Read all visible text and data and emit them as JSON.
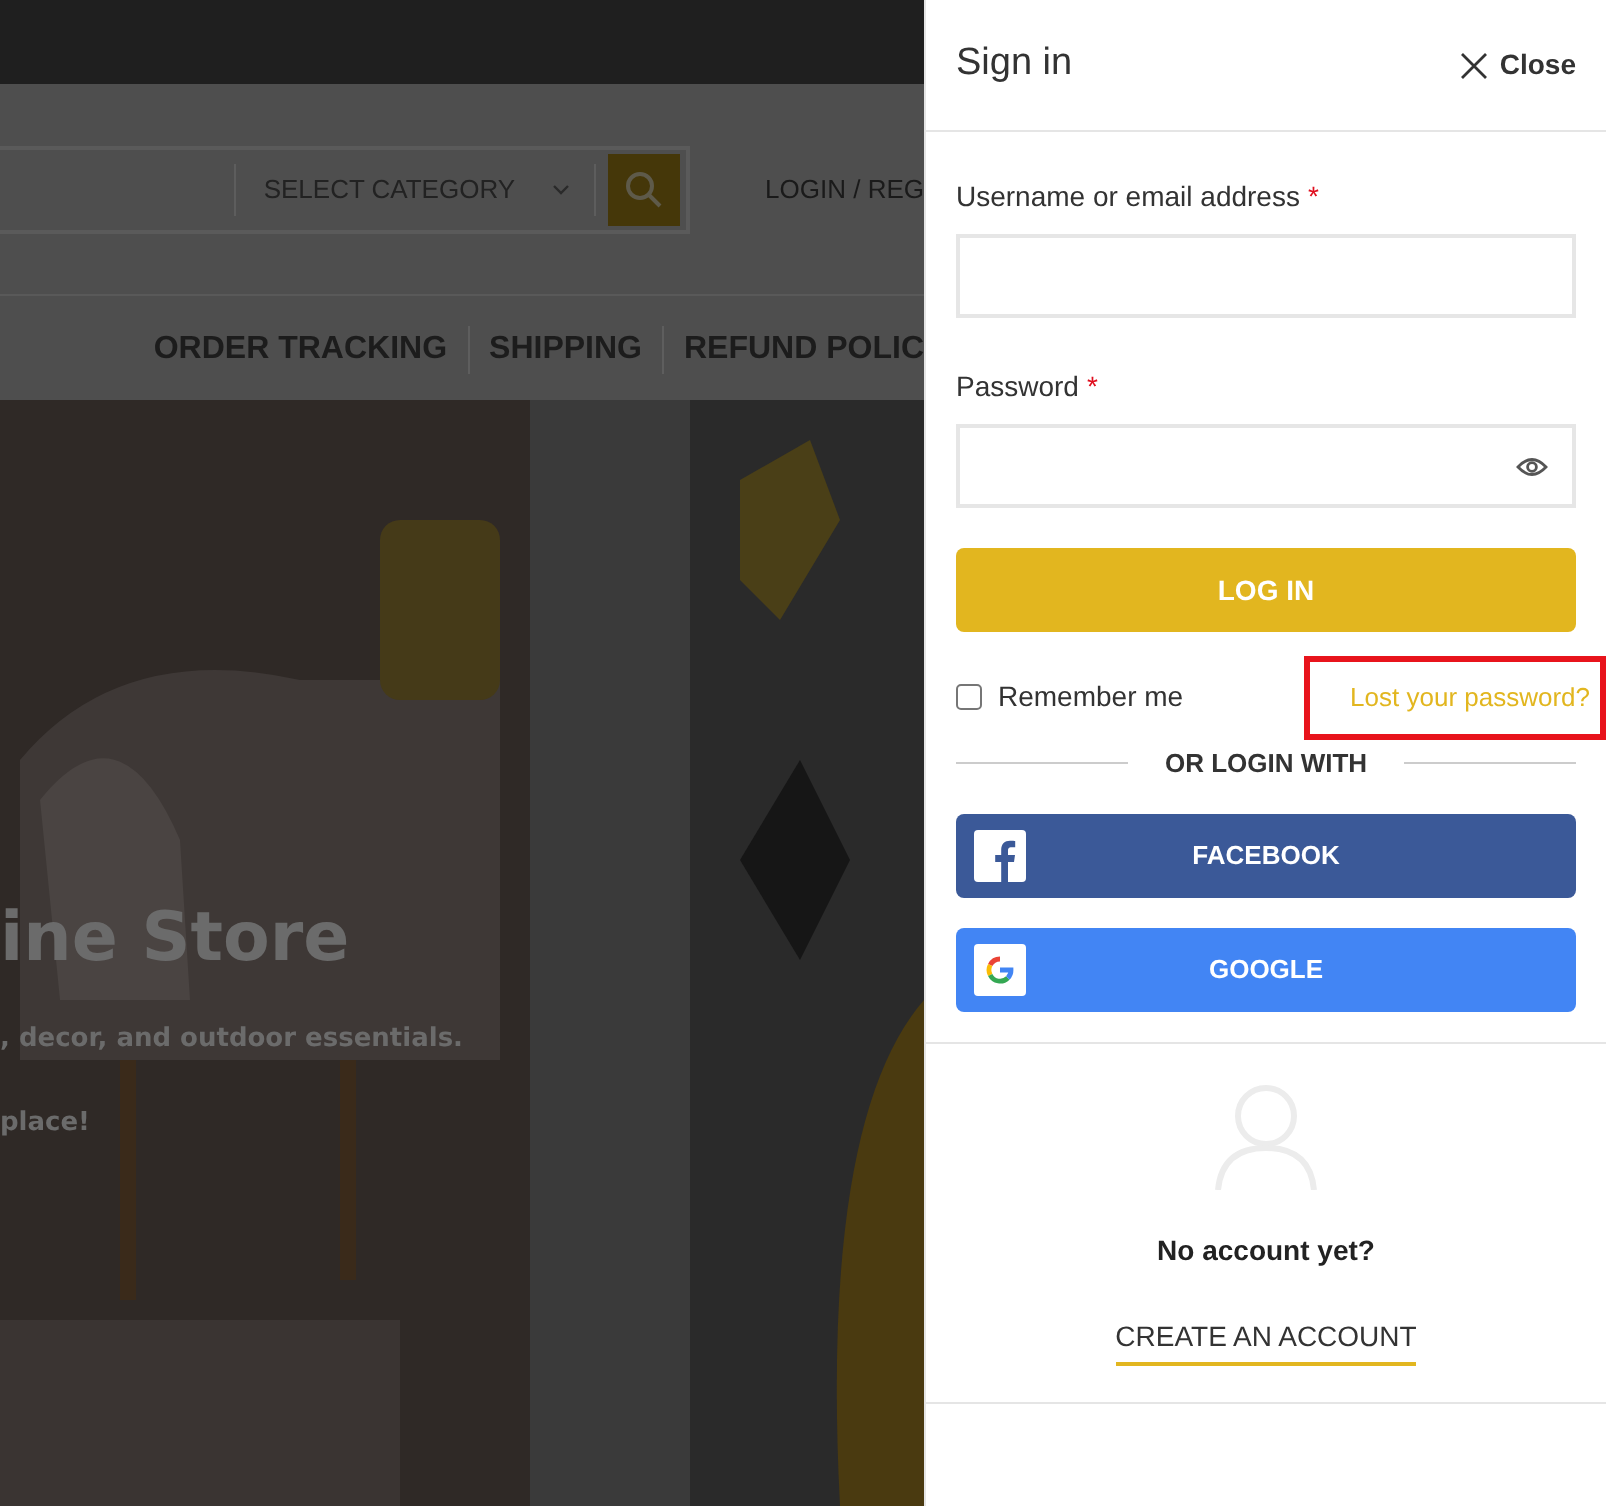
{
  "header": {
    "search_category": "SELECT CATEGORY",
    "account_link": "LOGIN / REG"
  },
  "nav": [
    "ORDER TRACKING",
    "SHIPPING",
    "REFUND POLIC"
  ],
  "hero": {
    "title": "ine Store",
    "subtitle": ", decor, and outdoor essentials.",
    "tagline": "place!"
  },
  "drawer": {
    "title": "Sign in",
    "close": "Close",
    "fields": [
      {
        "label": "Username or email address",
        "required_mark": "*",
        "kind": "text"
      },
      {
        "label": "Password",
        "required_mark": "*",
        "kind": "password"
      }
    ],
    "login_button": "LOG IN",
    "remember": {
      "label": "Remember me",
      "checked": false
    },
    "lost_password": {
      "text": "Lost your password?",
      "highlighted": true
    },
    "divider": "OR LOGIN WITH",
    "social": [
      {
        "kind": "facebook",
        "label": "FACEBOOK"
      },
      {
        "kind": "google",
        "label": "GOOGLE"
      }
    ],
    "register": {
      "prompt": "No account yet?",
      "link": "CREATE AN ACCOUNT"
    }
  }
}
